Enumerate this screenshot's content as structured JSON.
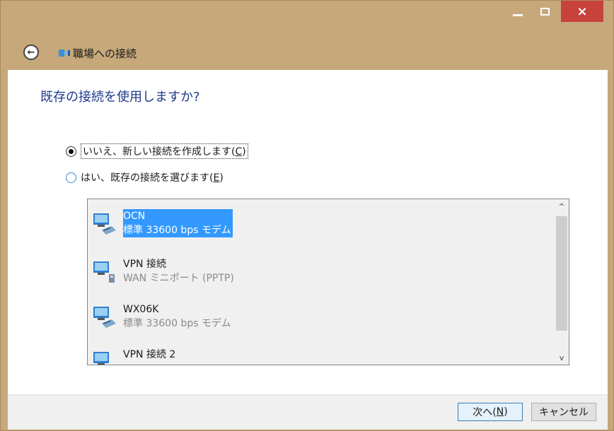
{
  "window": {
    "close_symbol": "×"
  },
  "nav": {
    "back_symbol": "←",
    "title": "職場への接続"
  },
  "main": {
    "heading": "既存の接続を使用しますか?",
    "options": [
      {
        "label": "いいえ、新しい接続を作成します(",
        "key": "C",
        "suffix": ")",
        "checked": true
      },
      {
        "label": "はい、既存の接続を選びます(",
        "key": "E",
        "suffix": ")",
        "checked": false
      }
    ],
    "connections": [
      {
        "name": "OCN",
        "device": "標準 33600 bps モデム",
        "selected": true
      },
      {
        "name": "VPN 接続",
        "device": "WAN ミニポート (PPTP)",
        "selected": false
      },
      {
        "name": "WX06K",
        "device": "標準 33600 bps モデム",
        "selected": false
      },
      {
        "name": "VPN 接続 2",
        "device": "",
        "selected": false
      }
    ],
    "scroll_up_symbol": "^",
    "scroll_down_symbol": "v"
  },
  "footer": {
    "next_label": "次へ(",
    "next_key": "N",
    "next_suffix": ")",
    "cancel_label": "キャンセル"
  },
  "colors": {
    "titlebar": "#c6a87a",
    "close": "#c7423a",
    "heading": "#1e3a8a",
    "selection": "#3399ff"
  }
}
